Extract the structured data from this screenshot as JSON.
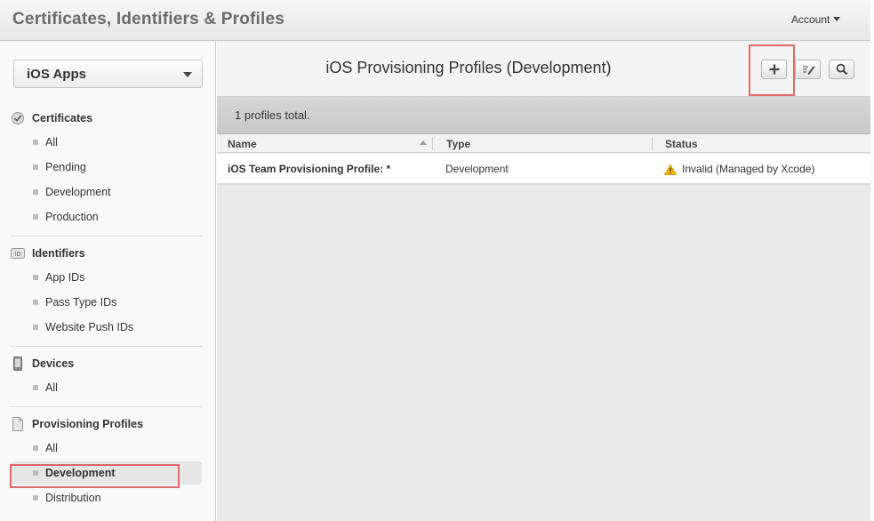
{
  "header": {
    "title": "Certificates, Identifiers & Profiles",
    "account_label": "Account"
  },
  "sidebar": {
    "platform_select": "iOS Apps",
    "sections": [
      {
        "title": "Certificates",
        "icon": "certificate-icon",
        "items": [
          "All",
          "Pending",
          "Development",
          "Production"
        ]
      },
      {
        "title": "Identifiers",
        "icon": "id-badge-icon",
        "items": [
          "App IDs",
          "Pass Type IDs",
          "Website Push IDs"
        ]
      },
      {
        "title": "Devices",
        "icon": "device-icon",
        "items": [
          "All"
        ]
      },
      {
        "title": "Provisioning Profiles",
        "icon": "document-icon",
        "items": [
          "All",
          "Development",
          "Distribution"
        ],
        "active": "Development"
      }
    ]
  },
  "main": {
    "heading": "iOS Provisioning Profiles (Development)",
    "toolbar": {
      "add": "plus-icon",
      "edit": "edit-icon",
      "search": "search-icon"
    },
    "total": "1 profiles total.",
    "columns": [
      "Name",
      "Type",
      "Status"
    ],
    "rows": [
      {
        "name": "iOS Team Provisioning Profile: *",
        "type": "Development",
        "status": "Invalid (Managed by Xcode)",
        "status_icon": "warning-icon"
      }
    ]
  },
  "colors": {
    "highlight": "#e06a64",
    "warning": "#f0b400"
  }
}
